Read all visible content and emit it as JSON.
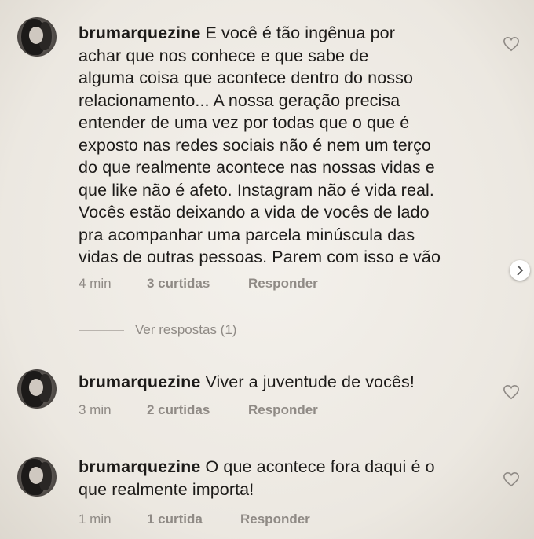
{
  "comments": [
    {
      "username": "brumarquezine",
      "text_lines": [
        "E você é tão ingênua por",
        "achar que nos conhece e que sabe de",
        "alguma coisa que acontece dentro do nosso",
        "relacionamento... A nossa geração precisa",
        "entender de uma vez por todas que o que é",
        "exposto nas redes sociais não é nem um terço",
        "do que realmente acontece nas nossas vidas e",
        "que like não é afeto. Instagram não é vida real.",
        "Vocês estão deixando a vida de vocês de lado",
        "pra acompanhar uma parcela minúscula das",
        "vidas de outras pessoas. Parem com isso e vão"
      ],
      "time": "4 min",
      "likes": "3 curtidas",
      "reply": "Responder",
      "view_replies": "Ver respostas (1)"
    },
    {
      "username": "brumarquezine",
      "text_lines": [
        "Viver a juventude de vocês!"
      ],
      "time": "3 min",
      "likes": "2 curtidas",
      "reply": "Responder"
    },
    {
      "username": "brumarquezine",
      "text_lines": [
        "O que acontece fora daqui é o",
        "que realmente importa!"
      ],
      "time": "1 min",
      "likes": "1 curtida",
      "reply": "Responder"
    }
  ],
  "icons": {
    "heart": "heart-outline-icon",
    "next": "chevron-right-icon"
  },
  "colors": {
    "background": "#efebe5",
    "text": "#1d1b19",
    "muted": "#8f8a85"
  }
}
